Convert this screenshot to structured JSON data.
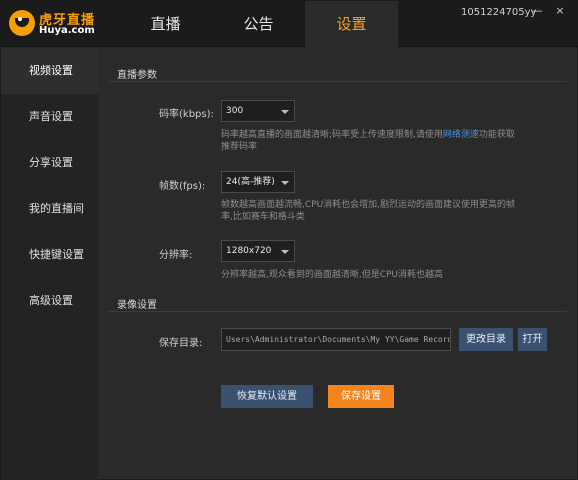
{
  "app": {
    "logo_title": "虎牙直播",
    "logo_sub": "Huya.com",
    "user_id": "1051224705yy",
    "minimize_glyph": "—",
    "close_glyph": "×"
  },
  "nav": {
    "tabs": [
      {
        "label": "直播"
      },
      {
        "label": "公告"
      },
      {
        "label": "设置",
        "active": true
      }
    ]
  },
  "sidebar": {
    "items": [
      {
        "label": "视频设置",
        "active": true
      },
      {
        "label": "声音设置"
      },
      {
        "label": "分享设置"
      },
      {
        "label": "我的直播间"
      },
      {
        "label": "快捷键设置"
      },
      {
        "label": "高级设置"
      }
    ]
  },
  "live_params": {
    "title": "直播参数",
    "bitrate": {
      "label": "码率(kbps):",
      "value": "300",
      "hint_before": "码率越高直播的画面越清晰;码率受上传速度限制,请使用",
      "hint_link": "网络测速",
      "hint_after": "功能获取推荐码率"
    },
    "framerate": {
      "label": "帧数(fps):",
      "value": "24(高-推荐)",
      "hint": "帧数越高画面越流畅,CPU消耗也会增加,剧烈运动的画面建议使用更高的帧率,比如赛车和格斗类"
    },
    "resolution": {
      "label": "分辨率:",
      "value": "1280x720",
      "hint": "分辨率越高,观众看到的画面越清晰,但是CPU消耗也越高"
    }
  },
  "recording": {
    "title": "录像设置",
    "save_dir_label": "保存目录:",
    "save_dir_value": "Users\\Administrator\\Documents\\My YY\\Game Record",
    "change_dir_label": "更改目录",
    "open_label": "打开"
  },
  "actions": {
    "restore_label": "恢复默认设置",
    "save_label": "保存设置"
  },
  "colors": {
    "accent": "#f5a623",
    "button_blue": "#3b5170",
    "button_orange": "#f5841f",
    "link": "#4a90e2"
  }
}
